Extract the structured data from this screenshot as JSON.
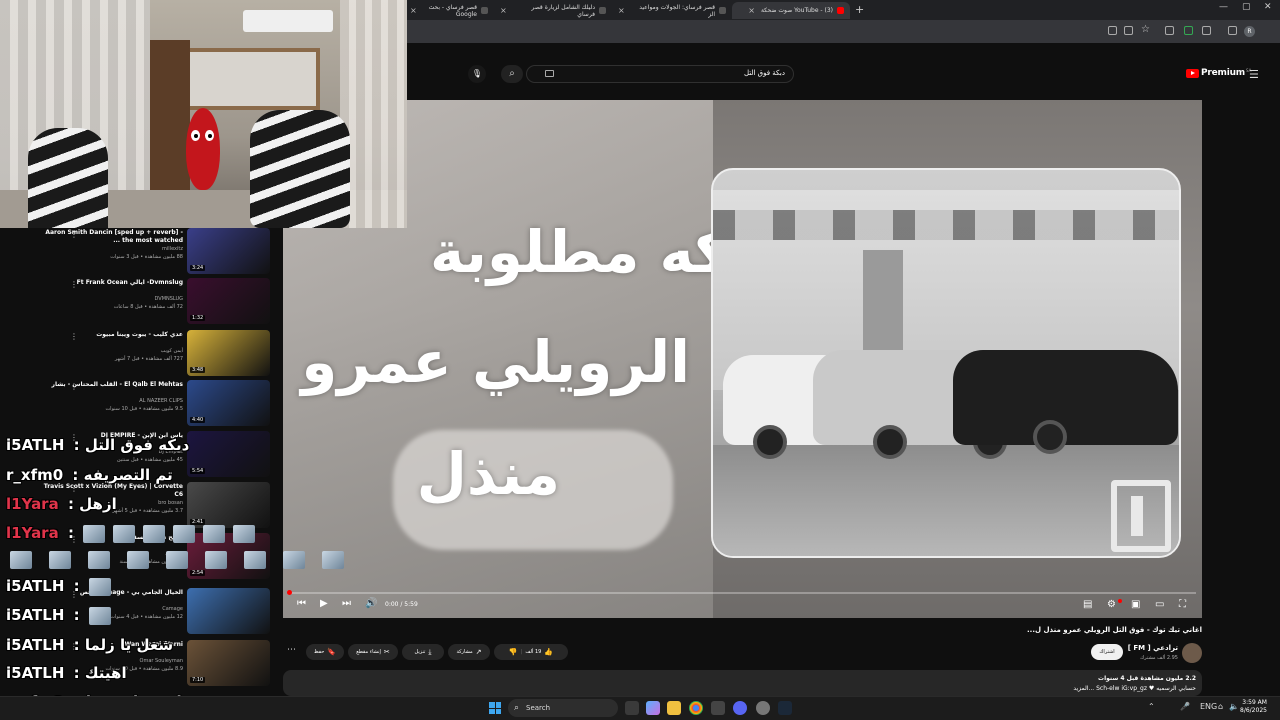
{
  "browser": {
    "tabs": [
      {
        "label": "قصر فرساي - بحث Google"
      },
      {
        "label": "دليلك الشامل لزيارة قصر فرساي"
      },
      {
        "label": "قصر فرساي: الجولات ومواعيد الز"
      },
      {
        "label": "YouTube - (3) صوت ضحكة",
        "active": true
      }
    ],
    "new_tab": "+"
  },
  "youtube": {
    "search_query": "دبكة فوق التل",
    "logo_word": "Premium",
    "logo_sup": "SA"
  },
  "video": {
    "overlay_lines": [
      "دبكه مطلوبة",
      "الرويلي عمرو",
      "منذل"
    ],
    "time": "0:00 / 5:59",
    "title": "اغاني تيك توك - فوق التل الرويلي عمرو منذل ل...",
    "channel": "ترادعي [ FM ]",
    "subscribers": "2.95 ألف مشترك",
    "subscribe": "اشتراك",
    "like_count": "19 ألف",
    "share": "مشاركة",
    "download": "تنزيل",
    "clip": "إنشاء مقطع",
    "save": "حفظ",
    "desc_line1": "2.2 مليون مشاهدة قبل 4 سنوات",
    "desc_line2": "حسابي الرسميه ♥ Sch-elw iG:vp_gz ...المزيد"
  },
  "recommendations": [
    {
      "title": "Aaron Smith Dancin [sped up + reverb] - the most watched ...",
      "channel": "millexitz",
      "meta": "88 مليون مشاهدة • قبل 3 سنوات",
      "duration": "3:24",
      "color": "#3a3f8a"
    },
    {
      "title": "Dvmnslug- ايالي Ft Frank Ocean",
      "channel": "DVMNSLUG",
      "meta": "72 ألف مشاهدة • قبل 8 ساعات",
      "duration": "1:32",
      "color": "#3a0e2e"
    },
    {
      "title": "عدي كليب - يبوت ويبنا مبيوت",
      "channel": "أيمن كويب",
      "meta": "727 ألف مشاهدة • قبل 7 أشهر",
      "duration": "3:48",
      "color": "#d7b23a"
    },
    {
      "title": "El Qalb El Mehtas - القلب المحتاس - بشار",
      "channel": "AL NAZEER CLIPS",
      "meta": "9.5 مليون مشاهدة • قبل 10 سنوات",
      "duration": "4:40",
      "color": "#2c4a8c"
    },
    {
      "title": "ياس ابن الإبن - DJ EMPIRE",
      "channel": "DJ Empire",
      "meta": "45 مليون مشاهدة • قبل سنتين",
      "duration": "5:54",
      "color": "#1c1540"
    },
    {
      "title": "Travis Scott x Vizion (My Eyes) | Corvette C6",
      "channel": "bro bosan",
      "meta": "3.7 مليون مشاهدة • قبل 5 أشهر",
      "duration": "2:41",
      "color": "#4a4a4a"
    },
    {
      "title": "صالح تي - مالسقني",
      "channel": "صالح تي",
      "meta": "1.2 مليون مشاهدة • قبل سنة",
      "duration": "2:54",
      "color": "#6a1c3a"
    },
    {
      "title": "الخيال الجامي بي - Camage رقص",
      "channel": "Camage",
      "meta": "12 مليون مشاهدة • قبل 4 سنوات",
      "duration": "",
      "color": "#3d6fb0"
    },
    {
      "title": "Wan Warni Warni",
      "channel": "Omar Souleyman",
      "meta": "8.9 مليون مشاهدة • قبل 10 سنوات",
      "duration": "7:10",
      "color": "#6b5238"
    }
  ],
  "chat": [
    {
      "user": "i5ATLH",
      "message": "دبكه فوق التل",
      "color": "#ffffff"
    },
    {
      "user": "r_xfm0",
      "message": "تم التصريفه",
      "color": "#ffffff"
    },
    {
      "user": "l1Yara",
      "message": "ازهل",
      "color": "#e0344a"
    },
    {
      "user": "l1Yara",
      "message": "",
      "color": "#e0344a",
      "emotes": 6
    },
    {
      "user": "i5ATLH",
      "message": "",
      "color": "#ffffff",
      "emotes": 1
    },
    {
      "user": "i5ATLH",
      "message": "",
      "color": "#ffffff",
      "emotes": 1
    },
    {
      "user": "i5ATLH",
      "message": "شغل يا زلما",
      "color": "#ffffff"
    },
    {
      "user": "i5ATLH",
      "message": "اهيتك",
      "color": "#ffffff"
    },
    {
      "user": "r_xfm0",
      "message": "اقعد باتفحيط",
      "color": "#ffffff"
    }
  ],
  "taskbar": {
    "search_placeholder": "Search",
    "time": "3:59 AM",
    "date": "8/6/2025",
    "lang": "ENG"
  }
}
